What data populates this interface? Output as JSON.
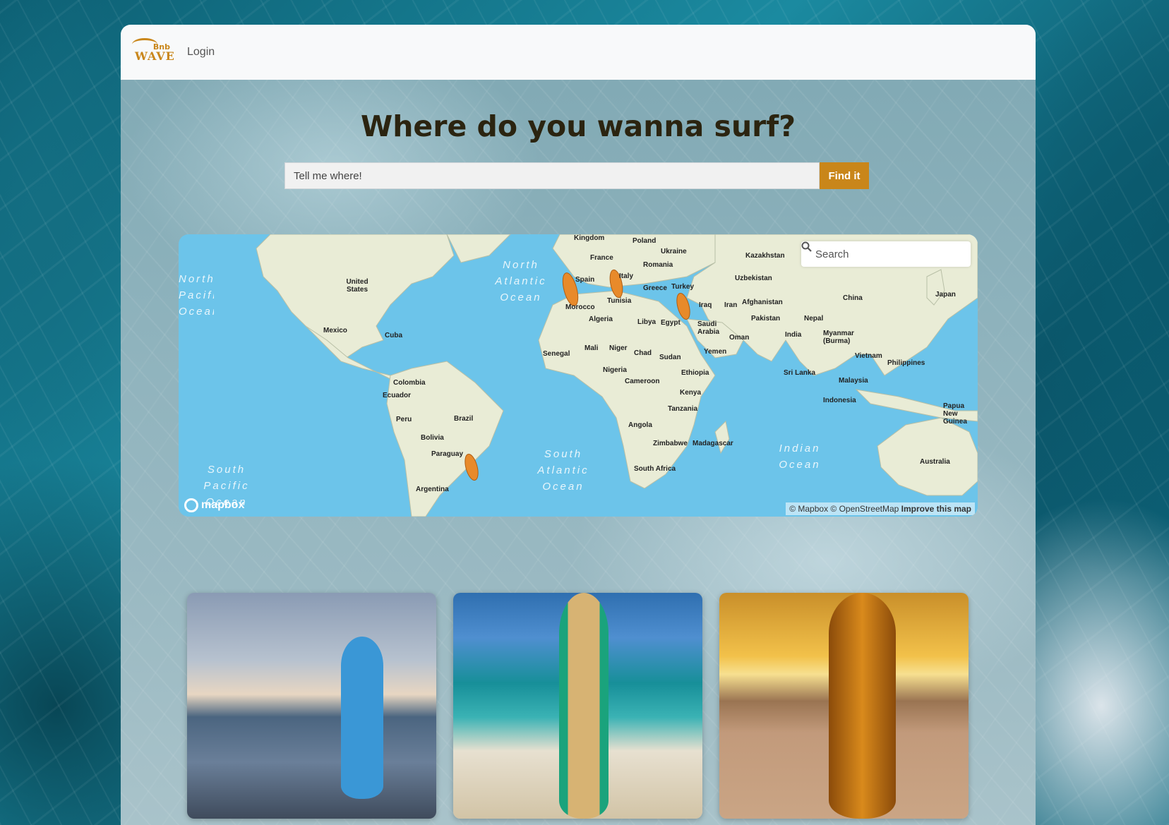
{
  "navbar": {
    "logo_top": "Bnb",
    "logo_word": "WAVE",
    "login_label": "Login"
  },
  "hero": {
    "title": "Where do you wanna surf?",
    "search_placeholder": "Tell me where!",
    "find_button": "Find it"
  },
  "map": {
    "search_placeholder": "Search",
    "attribution": "© Mapbox © OpenStreetMap",
    "improve_link": "Improve this map",
    "logo_text": "mapbox",
    "oceans": [
      "North Atlantic Ocean",
      "North Pacific Ocean",
      "South Atlantic Ocean",
      "South Pacific Ocean",
      "Indian Ocean"
    ],
    "countries": [
      "Kingdom",
      "Poland",
      "Ukraine",
      "France",
      "Romania",
      "Kazakhstan",
      "Italy",
      "Spain",
      "Uzbekistan",
      "Greece",
      "Turkey",
      "Morocco",
      "Tunisia",
      "Afghanistan",
      "Iraq",
      "Iran",
      "United States",
      "China",
      "Japan",
      "Algeria",
      "Libya",
      "Egypt",
      "Saudi Arabia",
      "Pakistan",
      "Nepal",
      "Mexico",
      "Cuba",
      "Oman",
      "India",
      "Myanmar (Burma)",
      "Mali",
      "Niger",
      "Chad",
      "Sudan",
      "Senegal",
      "Yemen",
      "Vietnam",
      "Philippines",
      "Nigeria",
      "Ethiopia",
      "Sri Lanka",
      "Colombia",
      "Cameroon",
      "Malaysia",
      "Ecuador",
      "Kenya",
      "Indonesia",
      "Papua New Guinea",
      "Peru",
      "Brazil",
      "Tanzania",
      "Angola",
      "Bolivia",
      "Zimbabwe",
      "Madagascar",
      "Paraguay",
      "South Africa",
      "Australia",
      "Argentina"
    ],
    "markers": [
      "Morocco surf spot",
      "Tunisia surf spot",
      "Egypt surf spot",
      "Brazil surf spot"
    ]
  },
  "cards": [
    {
      "name": "card-blue-board",
      "board_color": "#3a97d6"
    },
    {
      "name": "card-wood-board",
      "board_color": "#c9a468"
    },
    {
      "name": "card-sunset-board",
      "board_color": "#b36a12"
    }
  ]
}
